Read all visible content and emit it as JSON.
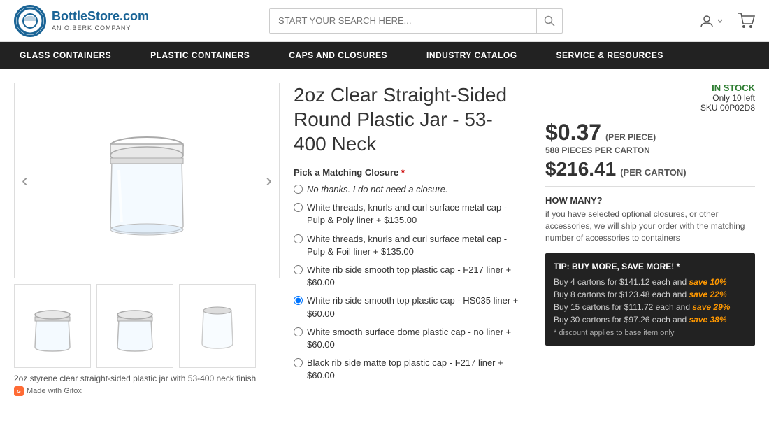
{
  "header": {
    "logo_main": "BottleStore.com",
    "logo_sub": "AN O.BERK COMPANY",
    "search_placeholder": "START YOUR SEARCH HERE...",
    "account_label": "Account",
    "cart_label": "Cart"
  },
  "nav": {
    "items": [
      {
        "label": "GLASS CONTAINERS"
      },
      {
        "label": "PLASTIC CONTAINERS"
      },
      {
        "label": "CAPS AND CLOSURES"
      },
      {
        "label": "INDUSTRY CATALOG"
      },
      {
        "label": "SERVICE & RESOURCES"
      }
    ]
  },
  "product": {
    "title": "2oz Clear Straight-Sided Round Plastic Jar - 53-400 Neck",
    "stock_status": "IN STOCK",
    "only_left": "Only 10 left",
    "sku_label": "SKU",
    "sku": "00P02D8",
    "price_per_piece": "$0.37",
    "per_piece_label": "(PER PIECE)",
    "pieces_per_carton": "588 PIECES PER CARTON",
    "price_per_carton": "$216.41",
    "per_carton_label": "(PER CARTON)",
    "how_many_label": "HOW MANY?",
    "how_many_text": "if you have selected optional closures, or other accessories, we will ship your order with the matching number of accessories to containers",
    "image_caption": "2oz styrene clear straight-sided plastic jar with 53-400 neck finish",
    "gifox_label": "Made with Gifox",
    "closure_label": "Pick a Matching Closure",
    "closure_required": "*",
    "closures": [
      {
        "text": "No thanks. I do not need a closure.",
        "selected": false,
        "style": "italic_link"
      },
      {
        "text": "White threads, knurls and curl surface metal cap - Pulp & Poly liner + $135.00",
        "selected": false
      },
      {
        "text": "White threads, knurls and curl surface metal cap - Pulp & Foil liner + $135.00",
        "selected": false
      },
      {
        "text": "White rib side smooth top plastic cap - F217 liner + $60.00",
        "selected": false
      },
      {
        "text": "White rib side smooth top plastic cap - HS035 liner + $60.00",
        "selected": true
      },
      {
        "text": "White smooth surface dome plastic cap - no liner + $60.00",
        "selected": false
      },
      {
        "text": "Black rib side matte top plastic cap - F217 liner + $60.00",
        "selected": false
      }
    ],
    "tip_title": "TIP: BUY MORE, SAVE MORE! *",
    "tip_rows": [
      {
        "text": "Buy 4 cartons for $141.12 each and ",
        "save": "save 10%"
      },
      {
        "text": "Buy 8 cartons for $123.48 each and ",
        "save": "save 22%"
      },
      {
        "text": "Buy 15 cartons for $111.72 each and ",
        "save": "save 29%"
      },
      {
        "text": "Buy 30 cartons for $97.26 each and ",
        "save": "save 38%"
      }
    ],
    "tip_disclaimer": "* discount applies to base item only"
  }
}
